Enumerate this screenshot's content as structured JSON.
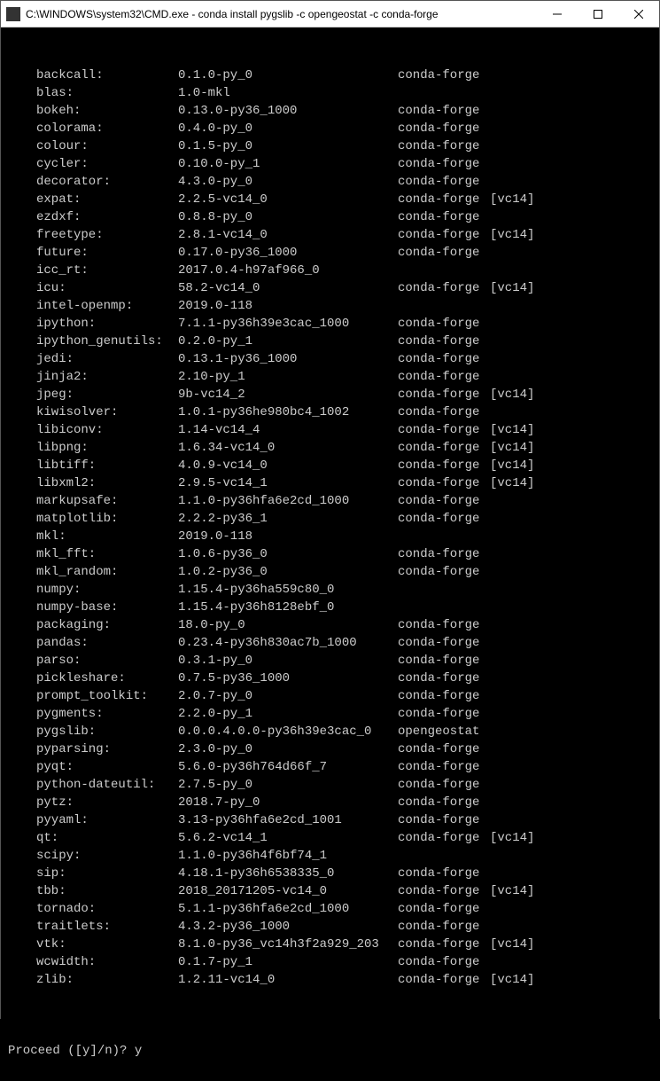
{
  "window": {
    "title": "C:\\WINDOWS\\system32\\CMD.exe - conda  install pygslib -c opengeostat -c conda-forge"
  },
  "packages": [
    {
      "name": "backcall:",
      "version": "0.1.0-py_0",
      "channel": "conda-forge",
      "extra": ""
    },
    {
      "name": "blas:",
      "version": "1.0-mkl",
      "channel": "",
      "extra": ""
    },
    {
      "name": "bokeh:",
      "version": "0.13.0-py36_1000",
      "channel": "conda-forge",
      "extra": ""
    },
    {
      "name": "colorama:",
      "version": "0.4.0-py_0",
      "channel": "conda-forge",
      "extra": ""
    },
    {
      "name": "colour:",
      "version": "0.1.5-py_0",
      "channel": "conda-forge",
      "extra": ""
    },
    {
      "name": "cycler:",
      "version": "0.10.0-py_1",
      "channel": "conda-forge",
      "extra": ""
    },
    {
      "name": "decorator:",
      "version": "4.3.0-py_0",
      "channel": "conda-forge",
      "extra": ""
    },
    {
      "name": "expat:",
      "version": "2.2.5-vc14_0",
      "channel": "conda-forge",
      "extra": "[vc14]"
    },
    {
      "name": "ezdxf:",
      "version": "0.8.8-py_0",
      "channel": "conda-forge",
      "extra": ""
    },
    {
      "name": "freetype:",
      "version": "2.8.1-vc14_0",
      "channel": "conda-forge",
      "extra": "[vc14]"
    },
    {
      "name": "future:",
      "version": "0.17.0-py36_1000",
      "channel": "conda-forge",
      "extra": ""
    },
    {
      "name": "icc_rt:",
      "version": "2017.0.4-h97af966_0",
      "channel": "",
      "extra": ""
    },
    {
      "name": "icu:",
      "version": "58.2-vc14_0",
      "channel": "conda-forge",
      "extra": "[vc14]"
    },
    {
      "name": "intel-openmp:",
      "version": "2019.0-118",
      "channel": "",
      "extra": ""
    },
    {
      "name": "ipython:",
      "version": "7.1.1-py36h39e3cac_1000",
      "channel": "conda-forge",
      "extra": ""
    },
    {
      "name": "ipython_genutils:",
      "version": "0.2.0-py_1",
      "channel": "conda-forge",
      "extra": ""
    },
    {
      "name": "jedi:",
      "version": "0.13.1-py36_1000",
      "channel": "conda-forge",
      "extra": ""
    },
    {
      "name": "jinja2:",
      "version": "2.10-py_1",
      "channel": "conda-forge",
      "extra": ""
    },
    {
      "name": "jpeg:",
      "version": "9b-vc14_2",
      "channel": "conda-forge",
      "extra": "[vc14]"
    },
    {
      "name": "kiwisolver:",
      "version": "1.0.1-py36he980bc4_1002",
      "channel": "conda-forge",
      "extra": ""
    },
    {
      "name": "libiconv:",
      "version": "1.14-vc14_4",
      "channel": "conda-forge",
      "extra": "[vc14]"
    },
    {
      "name": "libpng:",
      "version": "1.6.34-vc14_0",
      "channel": "conda-forge",
      "extra": "[vc14]"
    },
    {
      "name": "libtiff:",
      "version": "4.0.9-vc14_0",
      "channel": "conda-forge",
      "extra": "[vc14]"
    },
    {
      "name": "libxml2:",
      "version": "2.9.5-vc14_1",
      "channel": "conda-forge",
      "extra": "[vc14]"
    },
    {
      "name": "markupsafe:",
      "version": "1.1.0-py36hfa6e2cd_1000",
      "channel": "conda-forge",
      "extra": ""
    },
    {
      "name": "matplotlib:",
      "version": "2.2.2-py36_1",
      "channel": "conda-forge",
      "extra": ""
    },
    {
      "name": "mkl:",
      "version": "2019.0-118",
      "channel": "",
      "extra": ""
    },
    {
      "name": "mkl_fft:",
      "version": "1.0.6-py36_0",
      "channel": "conda-forge",
      "extra": ""
    },
    {
      "name": "mkl_random:",
      "version": "1.0.2-py36_0",
      "channel": "conda-forge",
      "extra": ""
    },
    {
      "name": "numpy:",
      "version": "1.15.4-py36ha559c80_0",
      "channel": "",
      "extra": ""
    },
    {
      "name": "numpy-base:",
      "version": "1.15.4-py36h8128ebf_0",
      "channel": "",
      "extra": ""
    },
    {
      "name": "packaging:",
      "version": "18.0-py_0",
      "channel": "conda-forge",
      "extra": ""
    },
    {
      "name": "pandas:",
      "version": "0.23.4-py36h830ac7b_1000",
      "channel": "conda-forge",
      "extra": ""
    },
    {
      "name": "parso:",
      "version": "0.3.1-py_0",
      "channel": "conda-forge",
      "extra": ""
    },
    {
      "name": "pickleshare:",
      "version": "0.7.5-py36_1000",
      "channel": "conda-forge",
      "extra": ""
    },
    {
      "name": "prompt_toolkit:",
      "version": "2.0.7-py_0",
      "channel": "conda-forge",
      "extra": ""
    },
    {
      "name": "pygments:",
      "version": "2.2.0-py_1",
      "channel": "conda-forge",
      "extra": ""
    },
    {
      "name": "pygslib:",
      "version": "0.0.0.4.0.0-py36h39e3cac_0",
      "channel": "opengeostat",
      "extra": ""
    },
    {
      "name": "pyparsing:",
      "version": "2.3.0-py_0",
      "channel": "conda-forge",
      "extra": ""
    },
    {
      "name": "pyqt:",
      "version": "5.6.0-py36h764d66f_7",
      "channel": "conda-forge",
      "extra": ""
    },
    {
      "name": "python-dateutil:",
      "version": "2.7.5-py_0",
      "channel": "conda-forge",
      "extra": ""
    },
    {
      "name": "pytz:",
      "version": "2018.7-py_0",
      "channel": "conda-forge",
      "extra": ""
    },
    {
      "name": "pyyaml:",
      "version": "3.13-py36hfa6e2cd_1001",
      "channel": "conda-forge",
      "extra": ""
    },
    {
      "name": "qt:",
      "version": "5.6.2-vc14_1",
      "channel": "conda-forge",
      "extra": "[vc14]"
    },
    {
      "name": "scipy:",
      "version": "1.1.0-py36h4f6bf74_1",
      "channel": "",
      "extra": ""
    },
    {
      "name": "sip:",
      "version": "4.18.1-py36h6538335_0",
      "channel": "conda-forge",
      "extra": ""
    },
    {
      "name": "tbb:",
      "version": "2018_20171205-vc14_0",
      "channel": "conda-forge",
      "extra": "[vc14]"
    },
    {
      "name": "tornado:",
      "version": "5.1.1-py36hfa6e2cd_1000",
      "channel": "conda-forge",
      "extra": ""
    },
    {
      "name": "traitlets:",
      "version": "4.3.2-py36_1000",
      "channel": "conda-forge",
      "extra": ""
    },
    {
      "name": "vtk:",
      "version": "8.1.0-py36_vc14h3f2a929_203",
      "channel": "conda-forge",
      "extra": "[vc14]"
    },
    {
      "name": "wcwidth:",
      "version": "0.1.7-py_1",
      "channel": "conda-forge",
      "extra": ""
    },
    {
      "name": "zlib:",
      "version": "1.2.11-vc14_0",
      "channel": "conda-forge",
      "extra": "[vc14]"
    }
  ],
  "prompt": {
    "question": "Proceed ([y]/n)? ",
    "answer": "y"
  }
}
